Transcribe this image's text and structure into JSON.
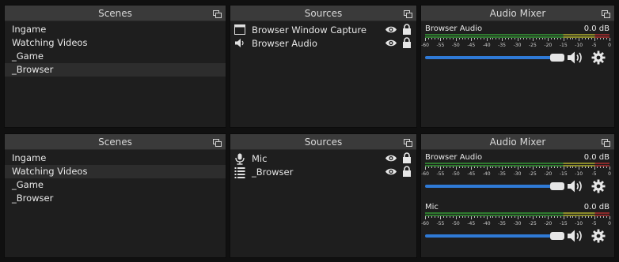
{
  "top": {
    "scenes": {
      "title": "Scenes",
      "items": [
        "Ingame",
        "Watching Videos",
        "_Game",
        "_Browser"
      ],
      "selected_index": 3
    },
    "sources": {
      "title": "Sources",
      "items": [
        {
          "label": "Browser Window Capture",
          "icon": "window-capture-icon"
        },
        {
          "label": "Browser Audio",
          "icon": "speaker-icon"
        }
      ]
    },
    "mixer": {
      "title": "Audio Mixer",
      "channels": [
        {
          "name": "Browser Audio",
          "db": "0.0 dB",
          "volume": 1.0
        }
      ]
    }
  },
  "bottom": {
    "scenes": {
      "title": "Scenes",
      "items": [
        "Ingame",
        "Watching Videos",
        "_Game",
        "_Browser"
      ],
      "selected_index": 1
    },
    "sources": {
      "title": "Sources",
      "items": [
        {
          "label": "Mic",
          "icon": "microphone-icon"
        },
        {
          "label": "_Browser",
          "icon": "scene-list-icon"
        }
      ]
    },
    "mixer": {
      "title": "Audio Mixer",
      "channels": [
        {
          "name": "Browser Audio",
          "db": "0.0 dB",
          "volume": 1.0
        },
        {
          "name": "Mic",
          "db": "0.0 dB",
          "volume": 1.0
        }
      ]
    }
  },
  "meter_scale": [
    "-60",
    "-55",
    "-50",
    "-45",
    "-40",
    "-35",
    "-30",
    "-25",
    "-20",
    "-15",
    "-10",
    "-5",
    "0"
  ],
  "colors": {
    "accent": "#2f7ad6",
    "meter_green": "#2f7a2f",
    "meter_yellow": "#8a8a2a",
    "meter_red": "#8a2a2a"
  }
}
